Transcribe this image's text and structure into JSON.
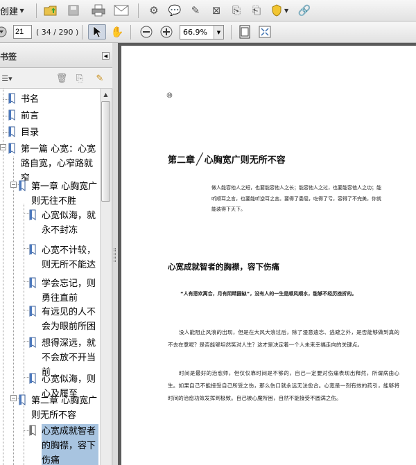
{
  "toolbar": {
    "create_label": "创建",
    "page_current": "21",
    "page_total": "( 34 / 290 )",
    "zoom_value": "66.9%"
  },
  "bookmarks_panel": {
    "title": "书签",
    "items": [
      {
        "label": "书名"
      },
      {
        "label": "前言"
      },
      {
        "label": "目录"
      },
      {
        "label": "第一篇  心宽：心宽路自宽，心窄路就窄"
      },
      {
        "label": "第一章  心胸宽广则无往不胜"
      },
      {
        "label": "心宽似海，就永不封冻"
      },
      {
        "label": "心宽不计较，则无所不能达"
      },
      {
        "label": "学会忘记，则勇往直前"
      },
      {
        "label": "有远见的人不会为眼前所困"
      },
      {
        "label": "想得深远，就不会放不开当前"
      },
      {
        "label": "心宽似海，则心及履至"
      },
      {
        "label": "第二章  心胸宽广则无所不容"
      },
      {
        "label": "心宽成就智者的胸襟，容下伤痛"
      }
    ]
  },
  "document": {
    "page_number": "⑩",
    "chapter_num": "第二章",
    "chapter_title": "心胸宽广则无所不容",
    "quote": "做人能容他人之短，也要能容他人之长；能容他人之过，也要能容他人之功；能听顺耳之言，也要能听逆耳之言。要得了委屈，吃得了亏，容得了不完美，你就能装得下天下。",
    "section_title": "心宽成就智者的胸襟，容下伤痛",
    "epigraph": "“人有悲欢离合，月有阴晴圆缺”，没有人的一生是顺风顺水，能够不经历挫折的。",
    "paragraphs": [
      "没人能阻止风浪的出现，但是在大风大浪过后，除了漫意遗忘、逃避之外，是否能够做到真的不去在意呢？是否能够坦然笑对人生？这才是决定着一个人未来幸福走向的关键点。",
      "时间是最好的治愈师，但仅仅靠时间是不够的，自己一定要对伤痛表现出释然，所谓病由心生。如果自己不能接受自己所受之伤，那么伤口就永远无法愈合。心宽是一剂有效的药引，能够将时间的治愈功效发挥到极致。自己被心魔所困，自然不能接受不圆满之伤。"
    ]
  }
}
